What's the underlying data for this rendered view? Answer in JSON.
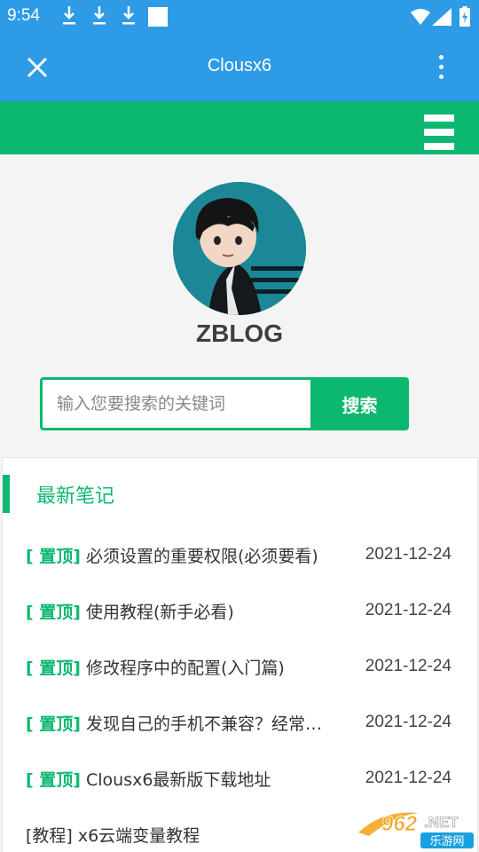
{
  "status_bar": {
    "time": "9:54",
    "icons": [
      "download-icon",
      "download-icon",
      "download-icon",
      "square-icon",
      "wifi-icon",
      "signal-icon",
      "battery-icon"
    ]
  },
  "app_bar": {
    "title": "Clousx6",
    "close_icon": "close-icon",
    "more_icon": "more-vert-icon"
  },
  "nav": {
    "menu_icon": "hamburger-icon"
  },
  "profile": {
    "site_name": "ZBLOG"
  },
  "search": {
    "placeholder": "输入您要搜索的关键词",
    "button_label": "搜索"
  },
  "notes": {
    "heading": "最新笔记",
    "items": [
      {
        "tag": "[ 置顶]",
        "title": "必须设置的重要权限(必须要看)",
        "date": "2021-12-24",
        "pinned": true
      },
      {
        "tag": "[ 置顶]",
        "title": "使用教程(新手必看)",
        "date": "2021-12-24",
        "pinned": true
      },
      {
        "tag": "[ 置顶]",
        "title": "修改程序中的配置(入门篇)",
        "date": "2021-12-24",
        "pinned": true
      },
      {
        "tag": "[ 置顶]",
        "title": "发现自己的手机不兼容？经常…",
        "date": "2021-12-24",
        "pinned": true
      },
      {
        "tag": "[ 置顶]",
        "title": "Clousx6最新版下载地址",
        "date": "2021-12-24",
        "pinned": true
      },
      {
        "tag": "[教程]",
        "title": "x6云端变量教程",
        "date": "",
        "pinned": false
      }
    ]
  },
  "watermark": {
    "number": "962",
    "suffix": ".NET",
    "site": "乐游网"
  },
  "colors": {
    "status_blue": "#2e9be6",
    "accent_green": "#0cb86f"
  }
}
